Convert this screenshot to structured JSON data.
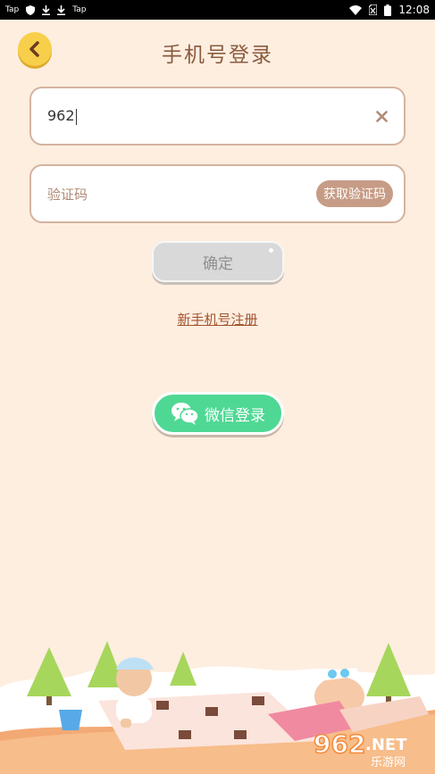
{
  "status_bar": {
    "left_items": [
      "Tap",
      "Tap"
    ],
    "time": "12:08"
  },
  "header": {
    "title": "手机号登录"
  },
  "phone_field": {
    "value": "962"
  },
  "code_field": {
    "placeholder": "验证码",
    "get_code_label": "获取验证码"
  },
  "confirm_label": "确定",
  "register_label": "新手机号注册",
  "wechat_label": "微信登录",
  "watermark": {
    "logo_text": "962.NET",
    "sub_text": "乐游网"
  },
  "colors": {
    "background": "#fdeee0",
    "accent_brown": "#8a5b3f",
    "wechat_green": "#4fd894",
    "back_yellow": "#f7cf4a"
  }
}
